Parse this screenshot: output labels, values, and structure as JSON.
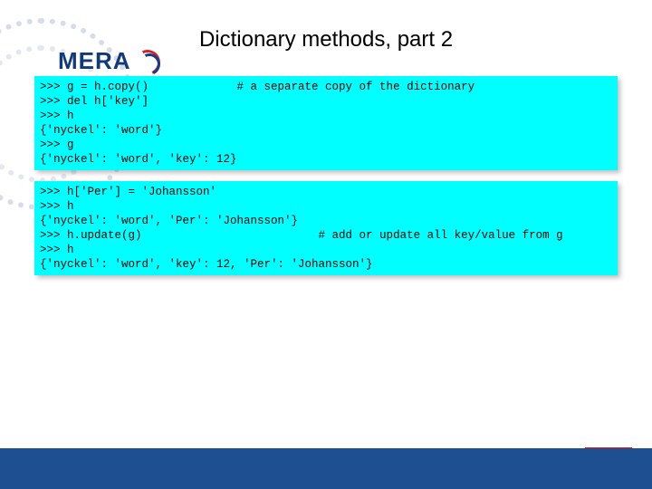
{
  "title": "Dictionary methods, part 2",
  "logo": {
    "text": "MERA"
  },
  "code_block_1": {
    "lines": [
      ">>> g = h.copy()             # a separate copy of the dictionary",
      ">>> del h['key']",
      ">>> h",
      "{'nyckel': 'word'}",
      ">>> g",
      "{'nyckel': 'word', 'key': 12}"
    ]
  },
  "code_block_2": {
    "lines": [
      ">>> h['Per'] = 'Johansson'",
      ">>> h",
      "{'nyckel': 'word', 'Per': 'Johansson'}",
      ">>> h.update(g)                          # add or update all key/value from g",
      ">>> h",
      "{'nyckel': 'word', 'key': 12, 'Per': 'Johansson'}"
    ]
  }
}
